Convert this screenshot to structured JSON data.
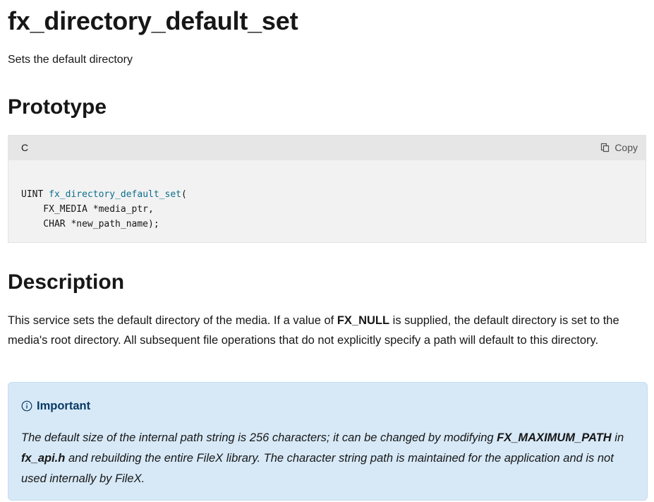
{
  "page": {
    "title": "fx_directory_default_set",
    "summary": "Sets the default directory"
  },
  "prototype": {
    "heading": "Prototype",
    "language": "C",
    "copy_label": "Copy",
    "code": {
      "return_type": "UINT ",
      "function_name": "fx_directory_default_set",
      "open_paren": "(",
      "param1": "    FX_MEDIA *media_ptr,",
      "param2": "    CHAR *new_path_name);"
    }
  },
  "description": {
    "heading": "Description",
    "text_before": "This service sets the default directory of the media. If a value of ",
    "bold_term": "FX_NULL",
    "text_after": " is supplied, the default directory is set to the media's root directory. All subsequent file operations that do not explicitly specify a path will default to this directory."
  },
  "important": {
    "title": "Important",
    "icon": "info-circle-icon",
    "part1": "The default size of the internal path string is 256 characters; it can be changed by modifying ",
    "bold1": "FX_MAXIMUM_PATH",
    "part2": " in ",
    "bold2": "fx_api.h",
    "part3": " and rebuilding the entire FileX library. The character string path is maintained for the application and is not used internally by FileX."
  },
  "colors": {
    "function_name": "#0e6e8c",
    "alert_background": "#d7e9f7",
    "alert_title": "#0b3a64",
    "code_background": "#f2f2f2"
  }
}
